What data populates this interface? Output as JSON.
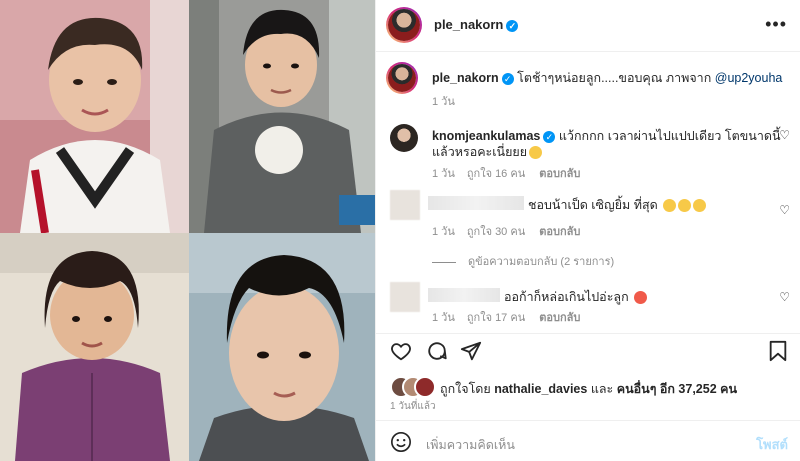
{
  "header": {
    "username": "ple_nakorn",
    "more_icon": "more-horizontal-icon"
  },
  "caption": {
    "username": "ple_nakorn",
    "text": "โตช้าๆหน่อยลูก.....ขอบคุณ ภาพจาก",
    "mention": "@up2youha",
    "time": "1 วัน"
  },
  "comments": [
    {
      "username": "knomjeankulamas",
      "line1": "แว้กกกก เวลาผ่านไปแปปเดียว โตขนาดนี้",
      "line2": "แล้วหรอคะเนี่ยยย",
      "time": "1 วัน",
      "likes": "ถูกใจ 16 คน",
      "reply": "ตอบกลับ"
    },
    {
      "username": "",
      "text": "ชอบน้าเป็ด เซิญยิ้ม ที่สุด",
      "time": "1 วัน",
      "likes": "ถูกใจ 30 คน",
      "reply": "ตอบกลับ",
      "view_replies": "ดูข้อความตอบกลับ (2 รายการ)"
    },
    {
      "username": "",
      "text": "ออก้าก็หล่อเกินไปอ่ะลูก",
      "time": "1 วัน",
      "likes": "ถูกใจ 17 คน",
      "reply": "ตอบกลับ"
    }
  ],
  "actions": {
    "like": "heart-icon",
    "comment": "comment-icon",
    "share": "send-icon",
    "save": "bookmark-icon"
  },
  "likes_line": {
    "prefix": "ถูกใจโดย",
    "user": "nathalie_davies",
    "mid": "และ",
    "others": "คนอื่นๆ อีก 37,252 คน"
  },
  "post_time": "1 วันที่แล้ว",
  "add_comment": {
    "placeholder": "เพิ่มความคิดเห็น",
    "post_label": "โพสต์",
    "emoji_icon": "smiley-icon"
  },
  "colors": {
    "link": "#00376b",
    "verified": "#0095f6",
    "muted": "#8e8e8e",
    "post_disabled": "#b2dffc"
  }
}
